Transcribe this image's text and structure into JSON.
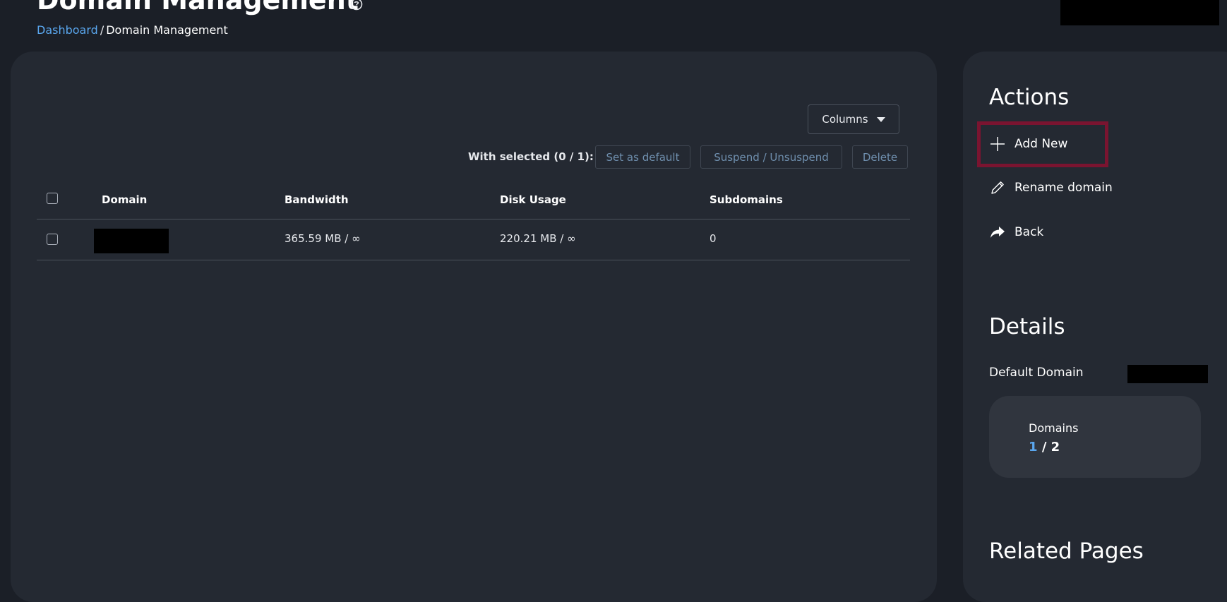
{
  "header": {
    "title": "Domain Management",
    "breadcrumb": {
      "home": "Dashboard",
      "separator": "/",
      "current": "Domain Management"
    }
  },
  "toolbar": {
    "columns_label": "Columns",
    "with_selected": "With selected (0 / 1):",
    "set_default_label": "Set as default",
    "suspend_label": "Suspend / Unsuspend",
    "delete_label": "Delete"
  },
  "table": {
    "headers": [
      "Domain",
      "Bandwidth",
      "Disk Usage",
      "Subdomains"
    ],
    "rows": [
      {
        "domain": "",
        "bandwidth": "365.59 MB / ∞",
        "disk_usage": "220.21 MB / ∞",
        "subdomains": "0"
      }
    ]
  },
  "actions": {
    "title": "Actions",
    "items": [
      {
        "label": "Add New",
        "icon": "plus-icon"
      },
      {
        "label": "Rename domain",
        "icon": "pencil-icon"
      },
      {
        "label": "Back",
        "icon": "share-arrow-icon"
      }
    ]
  },
  "details": {
    "title": "Details",
    "default_domain_label": "Default Domain",
    "domains_label": "Domains",
    "domains_used": "1",
    "domains_separator": "/",
    "domains_total": "2"
  },
  "related": {
    "title": "Related Pages"
  },
  "colors": {
    "background": "#1b1f27",
    "panel": "#242932",
    "accent": "#5aa7ef",
    "highlight": "#7a1430"
  }
}
